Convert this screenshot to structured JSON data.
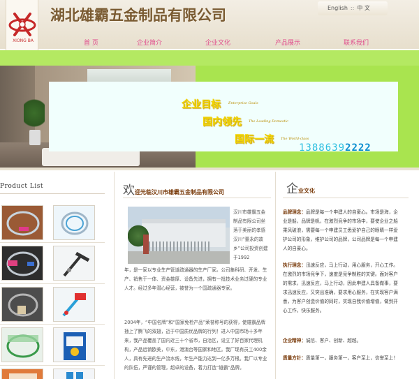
{
  "header": {
    "company_name": "湖北雄霸五金制品有限公司",
    "logo_text": "XIONG BA",
    "lang_en": "English",
    "lang_sep": "::",
    "lang_cn": "中 文"
  },
  "nav": {
    "items": [
      {
        "label": "首 页"
      },
      {
        "label": "企业简介"
      },
      {
        "label": "企业文化"
      },
      {
        "label": "产品展示"
      },
      {
        "label": "联系我们"
      }
    ]
  },
  "banner": {
    "slogan1": "企业目标",
    "slogan1_en": "Enterprise Goals",
    "slogan2": "国内领先",
    "slogan2_en": "The Leading Domestic",
    "slogan3": "国际一流",
    "slogan3_en": "The World-class",
    "phone_light": "1388639",
    "phone_dark": "2222"
  },
  "product_list": {
    "title": "Product List"
  },
  "welcome": {
    "big_char": "欢",
    "rest": "迎光临汉川市雄霸五金制品有限公司",
    "side_text": "汉川市雄霸五金制品有限公司坐落于美丽的孝感汉川“董永的故乡”公司投资创建于1992",
    "para1": "年，是一家以专业生产管道疏通器的生产厂家。公司集科研、开发、生产、销售于一体、资金雄厚、设备先进，拥有一批技术业务过硬的专业人才。经过多年潜心经营，被誉为一个国疏通器专家。",
    "para2": "2004年，“中国名牌”和“国家免检产品”荣誉称号的获得，使雄霸品牌插上了腾飞的双翅，迈于中国质优品牌的行列！进入中国市场十多年来，我产品覆盖了国内近三十个省市，自治区，设立了好百家代理机构，产品远销欧美，中东，港澳台等国家和地区。我厂现有员工400余人，具有先进的生产流水线，年生产能力达到一亿多万根。我厂以专业的队伍，严谨的管理，超卓的设备，着力打造“雄霸”品牌。"
  },
  "culture": {
    "big_char": "企",
    "rest": "业文化",
    "blocks": [
      {
        "label": "品牌理念：",
        "text": "品牌是每一个申建人的自豪心。市场是海，企业是船，品牌是帆，在激烈竞争的市场中，要使企业之船乘风破浪，需要每一个申建员工悉爱护自己的眼睛一样爱护公司的形象，维护公司的品牌，公司品牌是每一个申建人的自豪心。"
      },
      {
        "label": "执行理念：",
        "text": "迅速反应，马上行动，用心服务，开心工作。在激烈的市场竞争下，速度是竞争制胜的关键。面对客户的需求，迅速反应，马上行动，因此申建人具备做事，要求迅速反应，又突出准确，要求用心服务，在实现客户满意，为客户创造价值的同时，实现自我价值增值，做到开心工作，快乐服务。"
      },
      {
        "label": "企业精神：",
        "text": "诚信、客户、创新、超越。"
      },
      {
        "label": "质量方针：",
        "text": "质量第一，服务第一，客户至上，信誉至上！"
      }
    ]
  }
}
